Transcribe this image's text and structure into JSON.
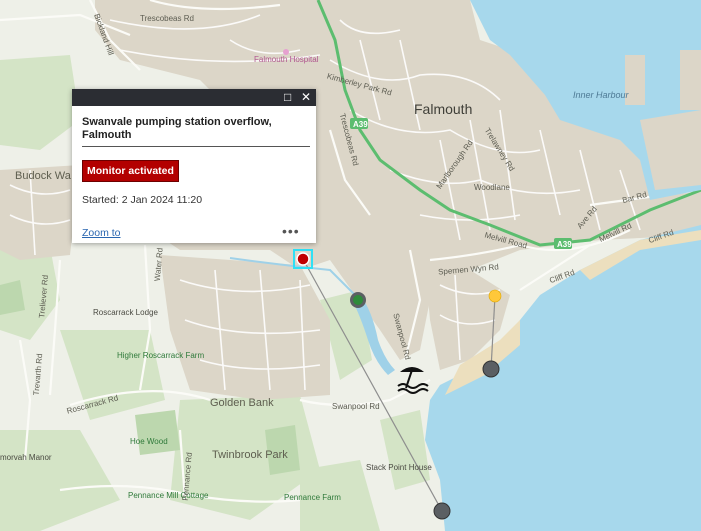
{
  "map": {
    "labels": {
      "falmouth": "Falmouth",
      "budock": "Budock Wa",
      "golden_bank": "Golden Bank",
      "twinbrook": "Twinbrook Park",
      "inner_harbour": "Inner Harbour",
      "hospital": "Falmouth Hospital",
      "roscarrack_lodge": "Roscarrack Lodge",
      "higher_roscarrack": "Higher Roscarrack Farm",
      "hoe_wood": "Hoe Wood",
      "pennance_mill": "Pennance Mill Cottage",
      "pennance_farm": "Pennance Farm",
      "stack_point": "Stack Point House",
      "morvah": "morvah Manor",
      "trescobeas": "Trescobeas Rd",
      "kimberley": "Kimberley Park Rd",
      "trescobeas_rd2": "Trescobeas Rd",
      "marlborough": "Marlborough Rd",
      "trelawney": "Trelawney Rd",
      "woodlane": "Woodlane",
      "melvill1": "Melvill Road",
      "melvill2": "Melvill Rd",
      "spernen": "Spernen Wyn Rd",
      "cliff1": "Cliff Rd",
      "cliff2": "Cliff Rd",
      "bar": "Bar Rd",
      "avenue": "Ave Rd",
      "swanpool_rd": "Swanpool Rd",
      "swanpool_st": "Swanpool Rd",
      "water_rd": "Water Rd",
      "treliever": "Treliever Rd",
      "trevarth": "Trevarth Rd",
      "roscarrack_rd": "Roscarrack Rd",
      "pennance_rd": "Pennance Rd",
      "bickland": "Bickland Hill",
      "a39_a": "A39",
      "a39_b": "A39"
    },
    "markers": {
      "selected_status": "red",
      "green_status": "green",
      "yellow_status": "yellow"
    },
    "colors": {
      "sea": "#a7d8ec",
      "land": "#eef0e8",
      "urban": "#dcd6c8",
      "road_major": "#5cbd6f",
      "alert": "#b30000"
    }
  },
  "popup": {
    "title": "Swanvale pumping station overflow, Falmouth",
    "badge": "Monitor activated",
    "started": "Started: 2 Jan 2024 11:20",
    "zoom_link": "Zoom to",
    "more": "•••",
    "maximize_icon": "maximize-icon",
    "close_icon": "close-icon"
  }
}
